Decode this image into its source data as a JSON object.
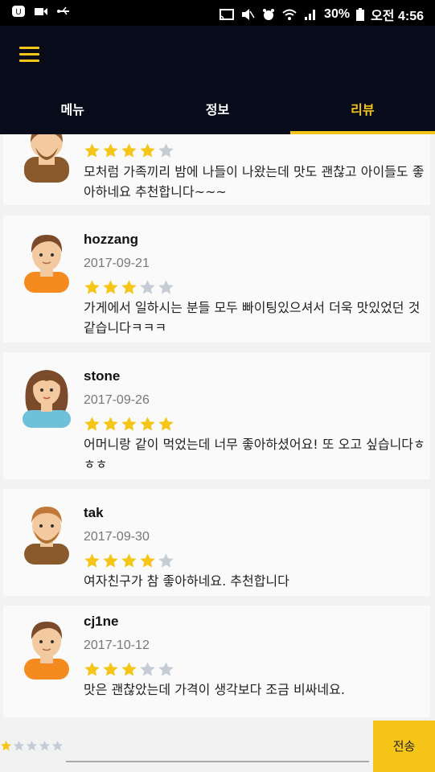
{
  "status_bar": {
    "battery": "30%",
    "time": "오전 4:56"
  },
  "tabs": [
    {
      "label": "메뉴",
      "active": false
    },
    {
      "label": "정보",
      "active": false
    },
    {
      "label": "리뷰",
      "active": true
    }
  ],
  "reviews": [
    {
      "name": "",
      "date": "",
      "rating": 4,
      "text": "모처럼 가족끼리 밤에 나들이 나왔는데 맛도 괜찮고 아이들도 좋아하네요 추천합니다~~~"
    },
    {
      "name": "hozzang",
      "date": "2017-09-21",
      "rating": 3,
      "text": "가게에서 일하시는 분들 모두 빠이팅있으셔서 더욱 맛있었던 것 같습니다ㅋㅋㅋ"
    },
    {
      "name": "stone",
      "date": "2017-09-26",
      "rating": 5,
      "text": "어머니랑 같이 먹었는데 너무 좋아하셨어요! 또 오고 싶습니다ㅎㅎㅎ"
    },
    {
      "name": "tak",
      "date": "2017-09-30",
      "rating": 4,
      "text": "여자친구가 참 좋아하네요. 추천합니다"
    },
    {
      "name": "cj1ne",
      "date": "2017-10-12",
      "rating": 3,
      "text": "맛은 괜찮았는데 가격이 생각보다 조금 비싸네요."
    }
  ],
  "composer": {
    "rating": 1,
    "placeholder": "",
    "send_label": "전송"
  },
  "colors": {
    "accent": "#f5c518",
    "header_bg": "#070b1a",
    "star_empty": "#c5ccd6"
  }
}
